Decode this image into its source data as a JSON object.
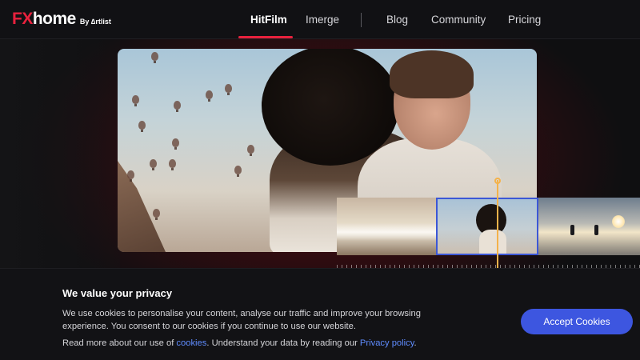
{
  "header": {
    "logo": {
      "fx": "FX",
      "home": "home",
      "by": "By ∆rtlist"
    },
    "nav": [
      {
        "label": "HitFilm",
        "active": true
      },
      {
        "label": "Imerge",
        "active": false
      },
      {
        "label": "Blog",
        "active": false
      },
      {
        "label": "Community",
        "active": false
      },
      {
        "label": "Pricing",
        "active": false
      }
    ]
  },
  "hero": {
    "playhead_position": 0.2
  },
  "cookie_banner": {
    "title": "We value your privacy",
    "text": "We use cookies to personalise your content, analyse our traffic and improve your browsing experience. You consent to our cookies if you continue to use our website.",
    "more_prefix": "Read more about our use of ",
    "cookies_link": "cookies",
    "more_middle": ". Understand your data by reading our ",
    "privacy_link": "Privacy policy",
    "more_suffix": ".",
    "accept_label": "Accept Cookies"
  },
  "colors": {
    "brand_red": "#e8213d",
    "accent_blue": "#3d56e0",
    "link_blue": "#5f8cff",
    "playhead": "#f4b24a"
  }
}
